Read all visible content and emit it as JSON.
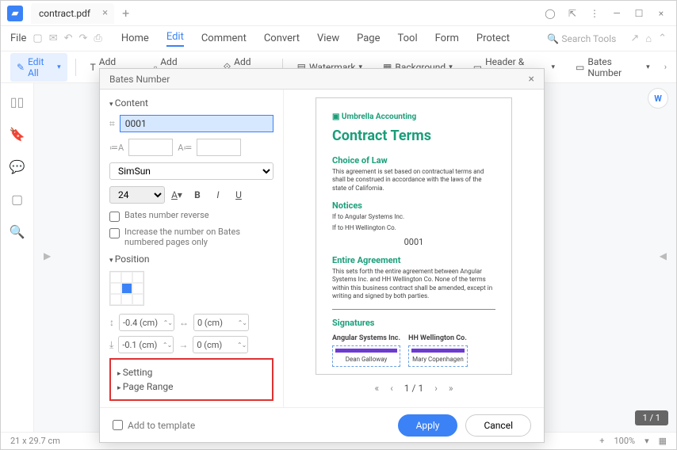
{
  "tab": {
    "title": "contract.pdf"
  },
  "menu": {
    "file": "File",
    "home": "Home",
    "edit": "Edit",
    "comment": "Comment",
    "convert": "Convert",
    "view": "View",
    "page": "Page",
    "tool": "Tool",
    "form": "Form",
    "protect": "Protect",
    "search_ph": "Search Tools"
  },
  "ribbon": {
    "edit_all": "Edit All",
    "add_text": "Add Text",
    "add_image": "Add Image",
    "add_link": "Add Link",
    "watermark": "Watermark",
    "background": "Background",
    "header_footer": "Header & Footer",
    "bates_number": "Bates Number"
  },
  "dialog": {
    "title": "Bates Number",
    "content": "Content",
    "number": "0001",
    "font": "SimSun",
    "font_size": "24",
    "reverse": "Bates number reverse",
    "increase": "Increase the number on Bates numbered pages only",
    "position": "Position",
    "offset1": "-0.4 (cm)",
    "offset2": "-0.1 (cm)",
    "offset3": "0 (cm)",
    "offset4": "0 (cm)",
    "setting": "Setting",
    "page_range": "Page Range",
    "add_template": "Add to template",
    "apply": "Apply",
    "cancel": "Cancel",
    "pager": "1 / 1"
  },
  "preview": {
    "brand": "▣ Umbrella Accounting",
    "title": "Contract Terms",
    "h1": "Choice of Law",
    "p1": "This agreement is set based on contractual terms and shall be construed in accordance with the laws of the state of California.",
    "h2": "Notices",
    "p2a": "If to Angular Systems Inc.",
    "p2b": "If to HH Wellington Co.",
    "bates": "0001",
    "h3": "Entire Agreement",
    "p3": "This sets forth the entire agreement between Angular Systems Inc. and HH Wellington Co. None of the terms within this business contract shall be amended, except in writing and signed by both parties.",
    "h4": "Signatures",
    "party1": "Angular Systems Inc.",
    "name1": "Dean Galloway",
    "party2": "HH Wellington Co.",
    "name2": "Mary Copenhagen"
  },
  "page_badge": "1 / 1",
  "status": {
    "dims": "21 x 29.7 cm",
    "zoom": "100%"
  }
}
